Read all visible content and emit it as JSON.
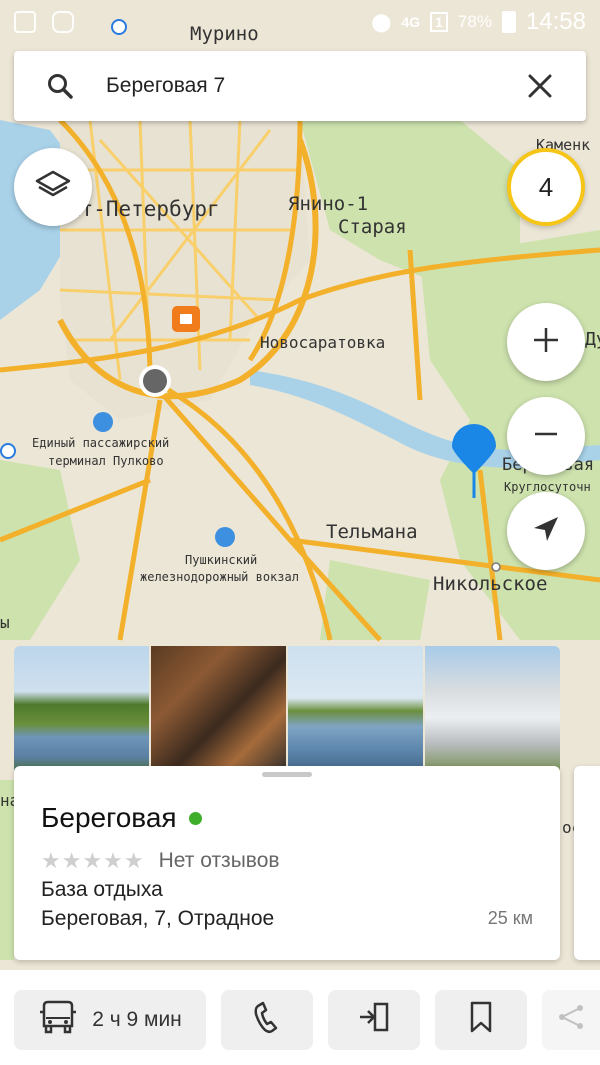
{
  "status_bar": {
    "time": "14:58",
    "battery": "78%",
    "network": "4G",
    "sim": "1"
  },
  "search": {
    "query": "Береговая 7",
    "icon": "search-icon",
    "clear_icon": "close-icon"
  },
  "map": {
    "labels": {
      "murino": "Мурино",
      "spb": "Санкт-Петербург",
      "yanino": "Янино-1",
      "staraya": "Старая",
      "kamenka": "Каменк",
      "dub": "Дуб",
      "novosaratovka": "Новосаратовка",
      "airport": "Единый пассажирский",
      "airport2": "терминал Пулково",
      "beregovaya": "Береговая",
      "kruglosut": "Круглосуточн",
      "telmana": "Тельмана",
      "pushkin": "Пушкинский",
      "pushkin2": "железнодорожный вокзал",
      "nikolskoe": "Никольское",
      "edge_left": "ы",
      "edge_left2": "на",
      "edge_right": "ос"
    },
    "results_count": "4",
    "layers_icon": "layers-icon",
    "zoom_in_icon": "plus-icon",
    "zoom_out_icon": "minus-icon",
    "locate_icon": "navigation-arrow-icon"
  },
  "place_card": {
    "name": "Береговая",
    "stars": "★★★★★",
    "reviews": "Нет отзывов",
    "category": "База отдыха",
    "address": "Береговая, 7, Отрадное",
    "distance": "25 км",
    "open_status_color": "#3fae2a"
  },
  "actions": {
    "route_label": "2 ч 9 мин",
    "route_icon": "car-icon",
    "call_icon": "phone-icon",
    "enter_icon": "entrance-icon",
    "bookmark_icon": "bookmark-icon",
    "share_icon": "share-icon"
  },
  "colors": {
    "accent_blue": "#1a86e6",
    "badge_yellow": "#f5c518",
    "water": "#aad3e8",
    "forest": "#cfe3b0",
    "road": "#f5b82e"
  }
}
